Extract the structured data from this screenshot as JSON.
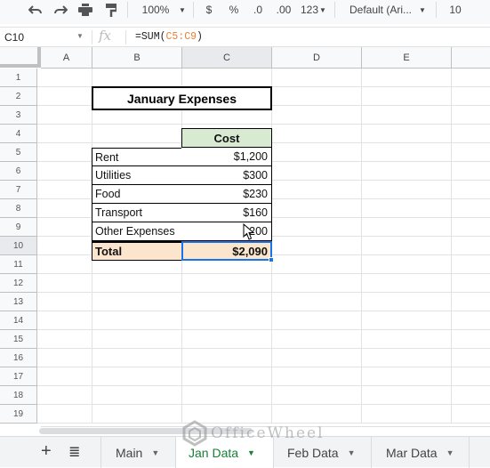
{
  "toolbar": {
    "icons": [
      "undo-icon",
      "redo-icon",
      "print-icon",
      "paint-format-icon"
    ],
    "zoom": "100%",
    "currency": "$",
    "percent": "%",
    "decrease_decimal": ".0",
    "increase_decimal": ".00",
    "more_formats": "123",
    "font": "Default (Ari...",
    "font_size": "10"
  },
  "formula_bar": {
    "cell_ref": "C10",
    "fx": "fx",
    "formula_prefix": "=SUM(",
    "formula_range": "C5:C9",
    "formula_suffix": ")"
  },
  "columns": [
    "A",
    "B",
    "C",
    "D",
    "E"
  ],
  "selected_column": "C",
  "rows": [
    "1",
    "2",
    "3",
    "4",
    "5",
    "6",
    "7",
    "8",
    "9",
    "10",
    "11",
    "12",
    "13",
    "14",
    "15",
    "16",
    "17",
    "18",
    "19"
  ],
  "selected_row": "10",
  "sheet": {
    "title": "January Expenses",
    "cost_header": "Cost",
    "items": [
      {
        "label": "Rent",
        "cost": "$1,200"
      },
      {
        "label": "Utilities",
        "cost": "$300"
      },
      {
        "label": "Food",
        "cost": "$230"
      },
      {
        "label": "Transport",
        "cost": "$160"
      },
      {
        "label": "Other Expenses",
        "cost": "$200"
      }
    ],
    "total_label": "Total",
    "total_value": "$2,090"
  },
  "tabs": {
    "add": "+",
    "list": "≣",
    "sheets": [
      {
        "label": "Main",
        "active": false
      },
      {
        "label": "Jan Data",
        "active": true
      },
      {
        "label": "Feb Data",
        "active": false
      },
      {
        "label": "Mar Data",
        "active": false
      }
    ]
  },
  "watermark": "OfficeWheel",
  "colors": {
    "cost_header_bg": "#d9ead3",
    "total_bg": "#fce5cd",
    "selection": "#1a73e8",
    "active_tab": "#188038",
    "formula_ref": "#e8803a"
  }
}
